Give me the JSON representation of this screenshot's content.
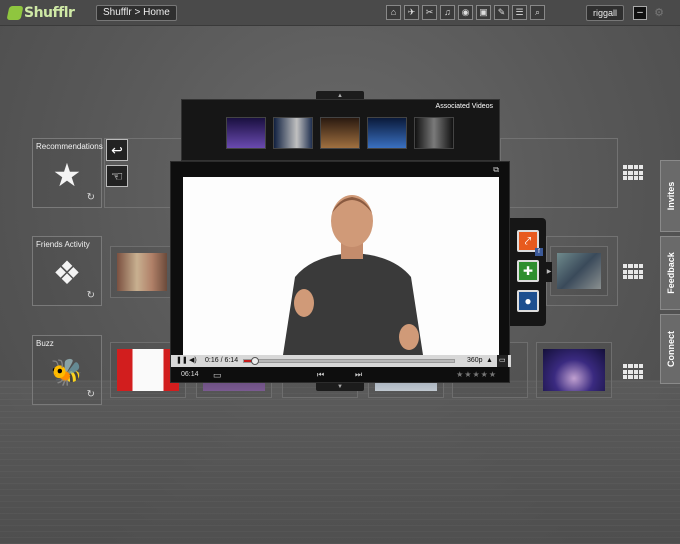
{
  "app": {
    "logo": "Shufflr",
    "breadcrumb": "Shufflr > Home"
  },
  "toolbar": {
    "tools": [
      "⌂",
      "✈",
      "✂",
      "♫",
      "◉",
      "▣",
      "✎",
      "☰",
      "⌕"
    ]
  },
  "user": {
    "name": "riggall",
    "minimize": "–",
    "settings": "⚙"
  },
  "categories": [
    {
      "label": "Recommendations",
      "icon": "★",
      "refresh": "↻"
    },
    {
      "label": "Friends Activity",
      "icon": "❖",
      "refresh": "↻"
    },
    {
      "label": "Buzz",
      "icon": "🐝",
      "refresh": "↻"
    }
  ],
  "side_buttons": {
    "back": "↩",
    "hand": "☜"
  },
  "tabs": [
    "Invites",
    "Feedback",
    "Connect"
  ],
  "associated": {
    "title": "Associated Videos",
    "up_arrow": "▲"
  },
  "player": {
    "elapsed": "0:16 / 6:14",
    "quality": "360p",
    "duration": "06:14",
    "progress": 0.05,
    "prev": "⏮",
    "next": "⏭",
    "stars": "★★★★★",
    "popout": "⧉",
    "down_arrow": "▼"
  },
  "share": {
    "share": "⤤",
    "add": "✚",
    "chat": "●",
    "fb": "f"
  },
  "colors": {
    "accent": "#8fc63f",
    "progress": "#c41b1b",
    "share_orange": "#e85a1e",
    "plus_green": "#2f8f2f"
  }
}
